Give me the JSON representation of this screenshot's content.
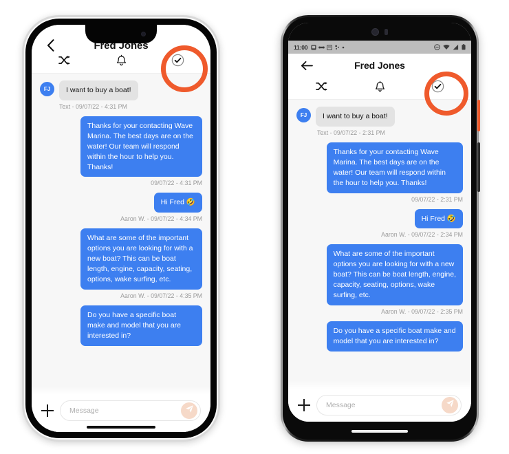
{
  "app": {
    "contact_name": "Fred Jones",
    "avatar_initials": "FJ",
    "accent_blue": "#3d7ff0",
    "highlight_orange": "#ef5a2c",
    "send_button_bg": "#f6d9c8"
  },
  "header": {
    "back_icon": "back-arrow-icon",
    "tabs": [
      {
        "icon": "shuffle-icon",
        "name": "shuffle"
      },
      {
        "icon": "bell-icon",
        "name": "notifications"
      },
      {
        "icon": "check-circle-icon",
        "name": "resolve"
      }
    ]
  },
  "android_status_bar": {
    "time": "11:00",
    "left_icons": [
      "sim-card-icon",
      "contacts-icon",
      "calendar-icon",
      "bluetooth-audio-icon",
      "dot-icon"
    ],
    "right_icons": [
      "do-not-disturb-icon",
      "wifi-icon",
      "cellular-signal-icon",
      "battery-icon"
    ]
  },
  "composer": {
    "placeholder": "Message",
    "value": "",
    "add_icon": "plus-icon",
    "send_icon": "send-paper-plane-icon"
  },
  "ios_conversation": [
    {
      "id": "m1",
      "direction": "in",
      "avatar": "FJ",
      "text": "I want to buy a boat!",
      "meta": "Text - 09/07/22 - 4:31 PM",
      "style": "incoming"
    },
    {
      "id": "m2",
      "direction": "out",
      "text": "Thanks for your contacting Wave Marina. The best days are on the water! Our team will respond within the hour to help you. Thanks!",
      "meta": "09/07/22 - 4:31 PM",
      "style": "blue"
    },
    {
      "id": "m3",
      "direction": "out",
      "text": "Hi Fred 🤣",
      "meta": "Aaron W. - 09/07/22 - 4:34 PM",
      "style": "blue"
    },
    {
      "id": "m4",
      "direction": "out",
      "text": "What are some of the important options you are looking for with a new boat? This can be boat length, engine, capacity, seating, options, wake surfing, etc.",
      "meta": "Aaron W. - 09/07/22 - 4:35 PM",
      "style": "blue"
    },
    {
      "id": "m5",
      "direction": "out",
      "text": "Do you have a specific boat make and model that you are interested in?",
      "meta": "",
      "style": "blue"
    }
  ],
  "android_conversation": [
    {
      "id": "a1",
      "direction": "in",
      "avatar": "FJ",
      "text": "I want to buy a boat!",
      "meta": "Text - 09/07/22 - 2:31 PM",
      "style": "incoming"
    },
    {
      "id": "a2",
      "direction": "out",
      "text": "Thanks for your contacting Wave Marina. The best days are on the water! Our team will respond within the hour to help you. Thanks!",
      "meta": "09/07/22 - 2:31 PM",
      "style": "blue"
    },
    {
      "id": "a3",
      "direction": "out",
      "text": "Hi Fred 🤣",
      "meta": "Aaron W. - 09/07/22 - 2:34 PM",
      "style": "blue"
    },
    {
      "id": "a4",
      "direction": "out",
      "text": "What are some of the important options you are looking for with a new boat? This can be boat length, engine, capacity, seating, options, wake surfing, etc.",
      "meta": "Aaron W. - 09/07/22 - 2:35 PM",
      "style": "blue"
    },
    {
      "id": "a5",
      "direction": "out",
      "text": "Do you have a specific boat make and model that you are interested in?",
      "meta": "",
      "style": "blue"
    }
  ]
}
